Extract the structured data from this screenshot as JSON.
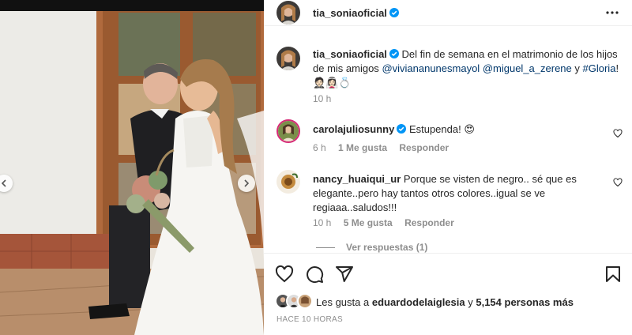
{
  "post": {
    "username": "tia_soniaoficial",
    "caption_prefix": "Del fin de semana en el matrimonio de los hijos de mis amigos",
    "mention_1": "@viviananunesmayol",
    "mention_2": "@miguel_a_zerene",
    "caption_and": "y",
    "hashtag": "#Gloria",
    "caption_suffix": "! 🤵🏻👰🏻‍♀️💍",
    "time": "10 h"
  },
  "comments": [
    {
      "username": "carolajuliosunny",
      "text": "Estupenda! 😍",
      "time": "6 h",
      "likes": "1 Me gusta",
      "reply": "Responder"
    },
    {
      "username": "nancy_huaiqui_ur",
      "text": "Porque se visten de negro.. sé que es elegante..pero hay tantos otros colores..igual se ve regiaaa..saludos!!!",
      "time": "10 h",
      "likes": "5 Me gusta",
      "reply": "Responder",
      "view_replies": "Ver respuestas (1)"
    }
  ],
  "likes": {
    "prefix": "Les gusta a",
    "user": "eduardodelaiglesia",
    "middle": "y",
    "count": "5,154 personas más"
  },
  "timeago": "HACE 10 HORAS",
  "colors": {
    "verified": "#0095f6",
    "link": "#00376b",
    "muted": "#8e8e8e"
  }
}
